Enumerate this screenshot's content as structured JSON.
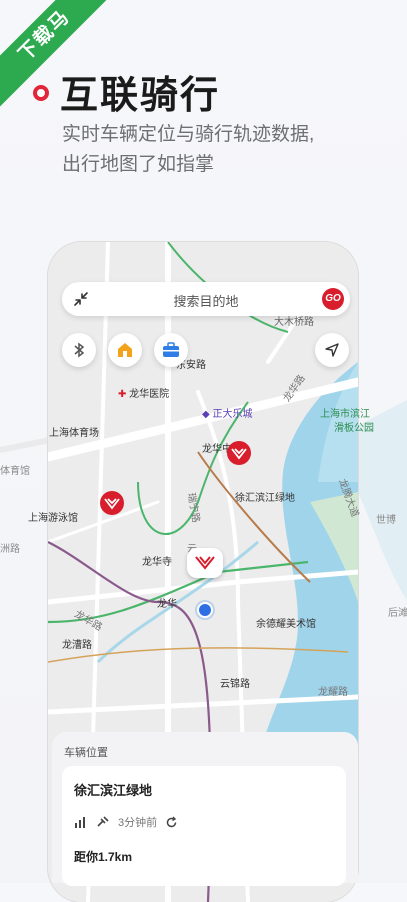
{
  "ribbon": {
    "label": "下载马"
  },
  "hero": {
    "title": "互联骑行",
    "subtitle_line1": "实时车辆定位与骑行轨迹数据,",
    "subtitle_line2": "出行地图了如指掌"
  },
  "search": {
    "placeholder": "搜索目的地",
    "go_label": "GO"
  },
  "map_labels": {
    "dongan_road": "东安路",
    "longhua_hospital": "龙华医院",
    "dade_bridge": "大木桥路",
    "zhengda": "正大乐城",
    "shanghai_stadium": "上海体育场",
    "longhua_middle": "龙华中",
    "shanghai_huangjiang": "上海市滨江",
    "skate_park": "滑板公园",
    "tiyuguan": "体育馆",
    "xuhui_binjiang": "徐汇滨江绿地",
    "swimming": "上海游泳馆",
    "rongxi_road": "洲路",
    "longhua_temple": "龙华寺",
    "longhua": "龙华",
    "longhua_road": "龙华路",
    "longcao": "龙漕路",
    "yude": "余德耀美术馆",
    "yunjin": "云锦路",
    "longyao": "龙耀路",
    "longhua_s_road": "龙华路",
    "shibo": "世博",
    "houtan": "后滩",
    "ruining": "瑞宁路",
    "longteng": "龙腾大道",
    "yun": "云"
  },
  "card": {
    "header": "车辆位置",
    "place": "徐汇滨江绿地",
    "time": "3分钟前",
    "distance": "距你1.7km"
  },
  "colors": {
    "accent_red": "#d81e2c",
    "ribbon_green": "#2daa4f",
    "river": "#9fd4ea",
    "metro_green": "#4bb56b",
    "metro_purple": "#8a5a8c",
    "metro_brown": "#b77b4a"
  },
  "icons": [
    "collapse-icon",
    "bluetooth-icon",
    "home-icon",
    "work-icon",
    "navigation-icon",
    "signal-icon",
    "satellite-icon",
    "refresh-icon",
    "bike-marker-icon",
    "location-dot-icon"
  ]
}
